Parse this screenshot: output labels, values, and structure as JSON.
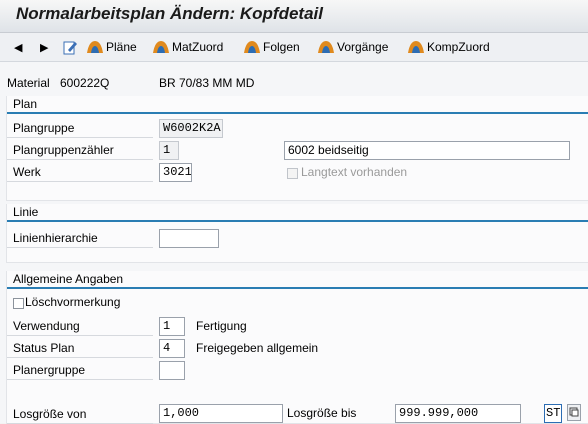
{
  "title": "Normalarbeitsplan Ändern: Kopfdetail",
  "toolbar": {
    "plaene": "Pläne",
    "matzuord": "MatZuord",
    "folgen": "Folgen",
    "vorgaenge": "Vorgänge",
    "kompzuord": "KompZuord"
  },
  "header": {
    "material_label": "Material",
    "material_value": "600222Q",
    "material_desc": "BR 70/83 MM MD"
  },
  "plan": {
    "title": "Plan",
    "plangruppe_label": "Plangruppe",
    "plangruppe_value": "W6002K2A",
    "zaehler_label": "Plangruppenzähler",
    "zaehler_value": "1",
    "zaehler_text": "6002 beidseitig",
    "werk_label": "Werk",
    "werk_value": "3021",
    "langtext_label": "Langtext vorhanden"
  },
  "linie": {
    "title": "Linie",
    "hierarchie_label": "Linienhierarchie",
    "hierarchie_value": ""
  },
  "allgemein": {
    "title": "Allgemeine Angaben",
    "loesch_label": "Löschvormerkung",
    "verwendung_label": "Verwendung",
    "verwendung_value": "1",
    "verwendung_text": "Fertigung",
    "status_label": "Status Plan",
    "status_value": "4",
    "status_text": "Freigegeben allgemein",
    "planergruppe_label": "Planergruppe",
    "planergruppe_value": "",
    "losvon_label": "Losgröße von",
    "losvon_value": "1,000",
    "losbis_label": "Losgröße bis",
    "losbis_value": "999.999,000",
    "unit_value": "ST"
  },
  "icons": [
    "back-icon",
    "forward-icon",
    "edit-icon",
    "plans-icon",
    "material-assign-icon",
    "sequences-icon",
    "operations-icon",
    "component-assign-icon",
    "matchcode-icon"
  ],
  "colors": {
    "accent": "#2a7db3",
    "title_text": "#1a1a1a",
    "icon_orange": "#e08a1e"
  }
}
